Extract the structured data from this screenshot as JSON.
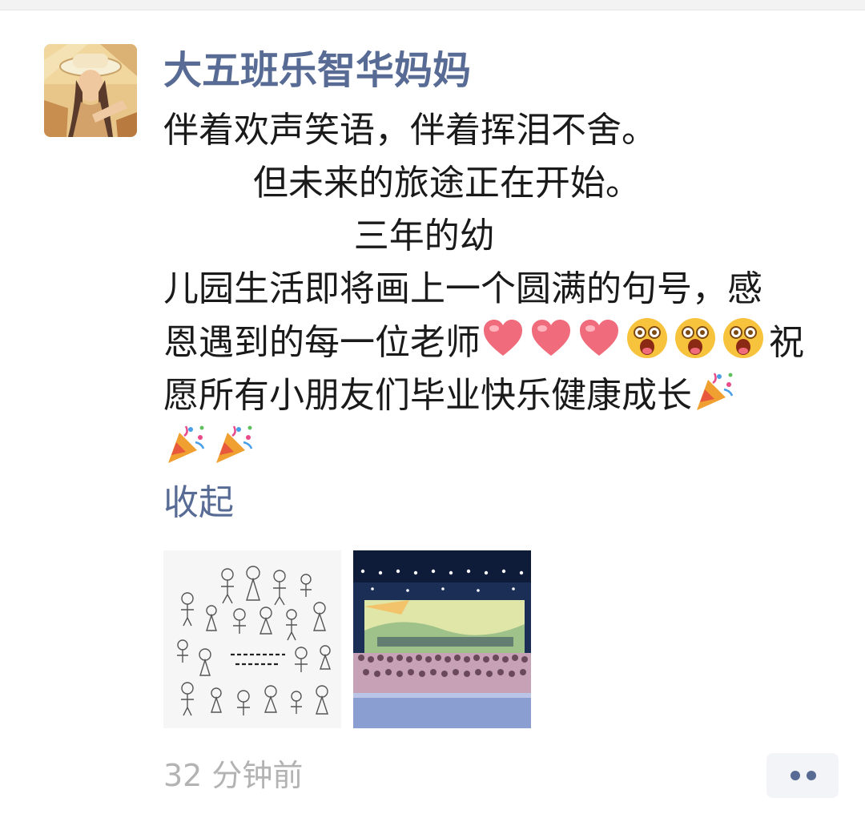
{
  "post": {
    "author": "大五班乐智华妈妈",
    "text_lines": [
      "伴着欢声笑语，伴着挥泪不舍。",
      "        但未来的旅途正在开始。",
      "                 三年的幼",
      "儿园生活即将画上一个圆满的句号，感",
      "恩遇到的每一位老师",
      "祝",
      "愿所有小朋友们毕业快乐健康成长"
    ],
    "emoji_names": [
      "heart-emoji",
      "heart-emoji",
      "heart-emoji",
      "excited-face-emoji",
      "excited-face-emoji",
      "excited-face-emoji",
      "party-popper-emoji"
    ],
    "collapse_label": "收起",
    "timestamp": "32 分钟前",
    "images": [
      {
        "name": "children-drawing-image",
        "icon": "image"
      },
      {
        "name": "graduation-stage-photo",
        "icon": "image"
      }
    ]
  },
  "colors": {
    "nickname": "#576b95",
    "link": "#576b95",
    "text": "#1a1a1a",
    "timestamp": "#b3b3b3",
    "more_dots": "#576b95",
    "more_bg": "#f3f4f7"
  },
  "icons": {
    "more": "more-dots-icon"
  }
}
